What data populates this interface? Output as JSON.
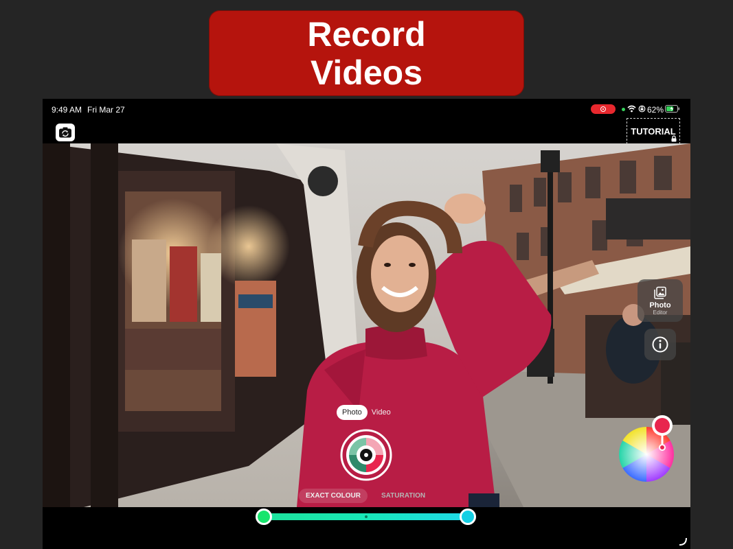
{
  "banner": {
    "line1": "Record",
    "line2": "Videos"
  },
  "status_bar": {
    "time": "9:49 AM",
    "date": "Fri Mar 27",
    "battery": "62%"
  },
  "header": {
    "tutorial_label": "TUTORIAL"
  },
  "camera_modes": {
    "photo": "Photo",
    "video": "Video",
    "selected": "Photo"
  },
  "adjust_tabs": {
    "exact_colour": "EXACT COLOUR",
    "saturation": "SATURATION",
    "selected": "EXACT COLOUR"
  },
  "side_panel": {
    "photo_editor_title": "Photo",
    "photo_editor_sub": "Editor"
  },
  "colors": {
    "banner": "#b5140d",
    "recording": "#e8282e",
    "slider_start": "#17e56d",
    "slider_end": "#14cfe4",
    "selected_color": "#e8264e"
  },
  "icons": [
    "camera-flip-icon",
    "wifi-icon",
    "battery-icon",
    "lock-icon",
    "gallery-icon",
    "info-icon",
    "color-wheel-icon"
  ]
}
